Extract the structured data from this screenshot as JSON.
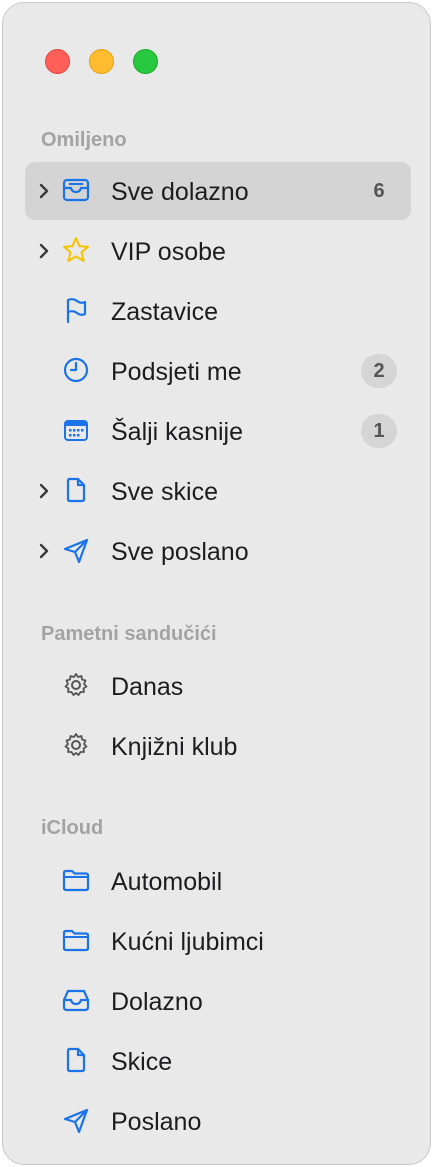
{
  "window": {
    "controls": [
      "close",
      "minimize",
      "maximize"
    ]
  },
  "sections": [
    {
      "title": "Omiljeno",
      "items": [
        {
          "label": "Sve dolazno",
          "icon": "inbox-tray-icon",
          "badge": "6",
          "expandable": true,
          "selected": true
        },
        {
          "label": "VIP osobe",
          "icon": "star-icon",
          "badge": "",
          "expandable": true
        },
        {
          "label": "Zastavice",
          "icon": "flag-icon",
          "badge": "",
          "expandable": false
        },
        {
          "label": "Podsjeti me",
          "icon": "clock-icon",
          "badge": "2",
          "expandable": false
        },
        {
          "label": "Šalji kasnije",
          "icon": "calendar-icon",
          "badge": "1",
          "expandable": false
        },
        {
          "label": "Sve skice",
          "icon": "document-icon",
          "badge": "",
          "expandable": true
        },
        {
          "label": "Sve poslano",
          "icon": "paper-plane-icon",
          "badge": "",
          "expandable": true
        }
      ]
    },
    {
      "title": "Pametni sandučići",
      "items": [
        {
          "label": "Danas",
          "icon": "gear-icon"
        },
        {
          "label": "Knjižni klub",
          "icon": "gear-icon"
        }
      ]
    },
    {
      "title": "iCloud",
      "items": [
        {
          "label": "Automobil",
          "icon": "folder-icon"
        },
        {
          "label": "Kućni ljubimci",
          "icon": "folder-icon"
        },
        {
          "label": "Dolazno",
          "icon": "inbox-tray-icon"
        },
        {
          "label": "Skice",
          "icon": "document-icon"
        },
        {
          "label": "Poslano",
          "icon": "paper-plane-icon"
        }
      ]
    }
  ],
  "colors": {
    "accent": "#1a73e8",
    "star": "#f5c400",
    "sidebar_bg": "#e9e9e9",
    "selected_row": "#d4d4d4",
    "section_header": "#a3a3a3"
  }
}
